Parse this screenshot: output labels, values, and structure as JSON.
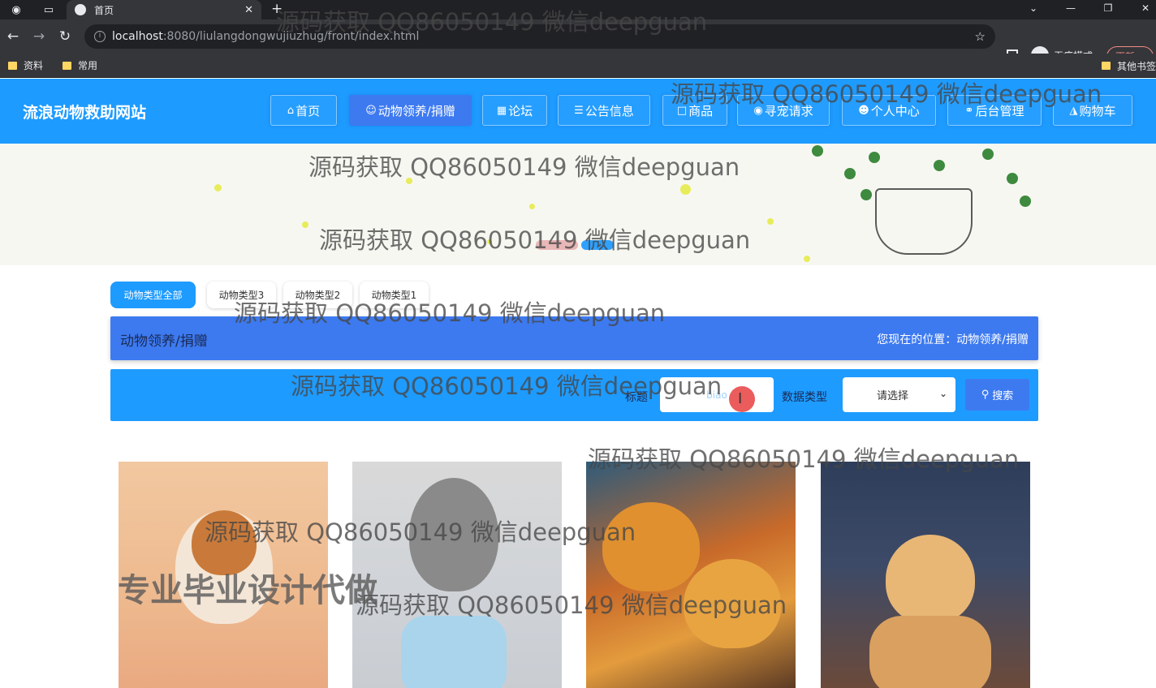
{
  "browser": {
    "tab_title": "首页",
    "url_host": "localhost",
    "url_rest": ":8080/liulangdongwujiuzhug/front/index.html",
    "incognito_label": "无痕模式",
    "update_label": "更新",
    "bookmarks": [
      "资料",
      "常用"
    ],
    "other_bookmarks": "其他书签"
  },
  "site": {
    "title": "流浪动物救助网站",
    "nav": [
      {
        "label": "首页",
        "icon": "home-icon"
      },
      {
        "label": "动物领养/捐赠",
        "icon": "paw-icon",
        "active": true
      },
      {
        "label": "论坛",
        "icon": "forum-icon"
      },
      {
        "label": "公告信息",
        "icon": "notice-icon"
      },
      {
        "label": "商品",
        "icon": "goods-icon"
      },
      {
        "label": "寻宠请求",
        "icon": "find-pet-icon"
      },
      {
        "label": "个人中心",
        "icon": "user-icon"
      },
      {
        "label": "后台管理",
        "icon": "link-icon"
      },
      {
        "label": "购物车",
        "icon": "cart-icon"
      }
    ]
  },
  "filters": [
    "动物类型全部",
    "动物类型3",
    "动物类型2",
    "动物类型1"
  ],
  "section": {
    "title": "动物领养/捐赠",
    "breadcrumb": "您现在的位置：动物领养/捐赠"
  },
  "search": {
    "title_label": "标题",
    "title_value": "biao",
    "type_label": "数据类型",
    "type_selected": "请选择",
    "button_label": "搜索"
  },
  "watermark": {
    "text": "源码获取 QQ86050149 微信deepguan",
    "big_text": "专业毕业设计代做"
  },
  "colors": {
    "header_blue": "#1e9bff",
    "active_blue": "#3d7af0",
    "chrome_dark": "#202124"
  }
}
